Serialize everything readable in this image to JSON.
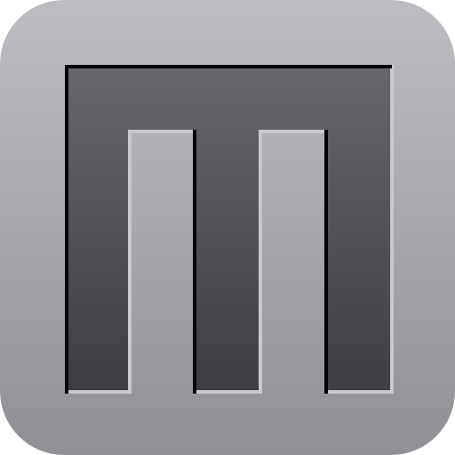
{
  "app_icon": {
    "icon": "m-letter-icon",
    "colors": {
      "tile_top": "#bcbdc1",
      "tile_bottom": "#8f9095",
      "glyph_top": "#66676c",
      "glyph_bottom": "#3d3e43",
      "shadow": "#000000",
      "highlight": "#c8c9cc"
    }
  }
}
